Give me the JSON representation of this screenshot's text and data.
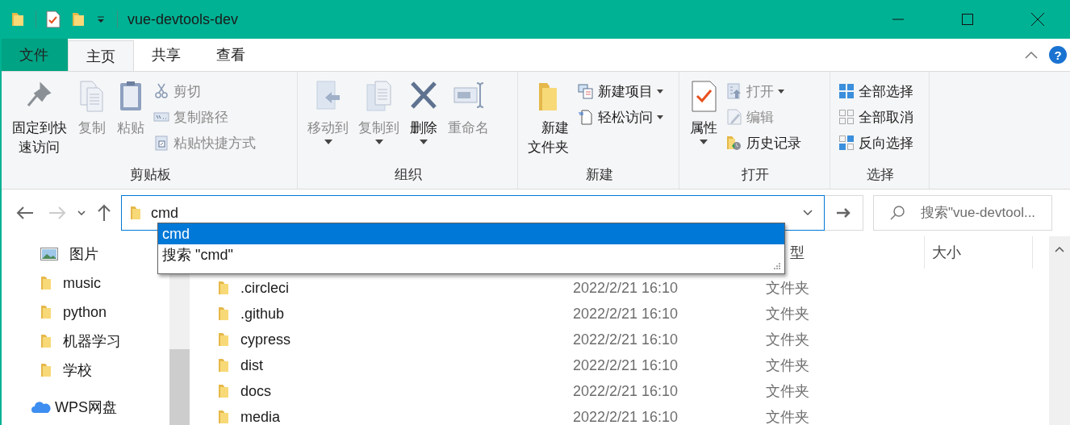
{
  "title_bar": {
    "title": "vue-devtools-dev"
  },
  "tabs": [
    {
      "label": "文件",
      "kind": "menu",
      "selected": false
    },
    {
      "label": "主页",
      "kind": "tab",
      "selected": true
    },
    {
      "label": "共享",
      "kind": "tab",
      "selected": false
    },
    {
      "label": "查看",
      "kind": "tab",
      "selected": false
    }
  ],
  "help": {
    "label": "?"
  },
  "ribbon": [
    {
      "label": "剪贴板",
      "large": [
        {
          "label": "固定到快速访问",
          "disabled": false,
          "dropdown": false
        },
        {
          "label": "复制",
          "disabled": true,
          "dropdown": false
        },
        {
          "label": "粘贴",
          "disabled": true,
          "dropdown": false
        }
      ],
      "small": [
        {
          "label": "剪切",
          "disabled": true,
          "dropdown": false
        },
        {
          "label": "复制路径",
          "disabled": true,
          "dropdown": false
        },
        {
          "label": "粘贴快捷方式",
          "disabled": true,
          "dropdown": false
        }
      ]
    },
    {
      "label": "组织",
      "large": [
        {
          "label": "移动到",
          "disabled": true,
          "dropdown": true
        },
        {
          "label": "复制到",
          "disabled": true,
          "dropdown": true
        },
        {
          "label": "删除",
          "disabled": false,
          "dropdown": true
        },
        {
          "label": "重命名",
          "disabled": true,
          "dropdown": false
        }
      ]
    },
    {
      "label": "新建",
      "large": [
        {
          "label": "新建文件夹",
          "disabled": false,
          "dropdown": false
        }
      ],
      "small": [
        {
          "label": "新建项目",
          "disabled": false,
          "dropdown": true
        },
        {
          "label": "轻松访问",
          "disabled": false,
          "dropdown": true
        }
      ]
    },
    {
      "label": "打开",
      "large": [
        {
          "label": "属性",
          "disabled": false,
          "dropdown": true
        }
      ],
      "small": [
        {
          "label": "打开",
          "disabled": true,
          "dropdown": true
        },
        {
          "label": "编辑",
          "disabled": true,
          "dropdown": false
        },
        {
          "label": "历史记录",
          "disabled": false,
          "dropdown": false
        }
      ]
    },
    {
      "label": "选择",
      "small": [
        {
          "label": "全部选择",
          "disabled": false,
          "dropdown": false
        },
        {
          "label": "全部取消",
          "disabled": false,
          "dropdown": false
        },
        {
          "label": "反向选择",
          "disabled": false,
          "dropdown": false
        }
      ]
    }
  ],
  "address_bar": {
    "value": "cmd",
    "back_disabled": false,
    "forward_disabled": true
  },
  "suggestions": [
    {
      "label": "cmd",
      "selected": true
    },
    {
      "label": "搜索 \"cmd\"",
      "selected": false
    }
  ],
  "search": {
    "placeholder": "搜索\"vue-devtool..."
  },
  "sidebar": {
    "items": [
      {
        "label": "图片",
        "kind": "pictures"
      },
      {
        "label": "music",
        "kind": "folder"
      },
      {
        "label": "python",
        "kind": "folder"
      },
      {
        "label": "机器学习",
        "kind": "folder"
      },
      {
        "label": "学校",
        "kind": "folder"
      },
      {
        "label": "WPS网盘",
        "kind": "cloud"
      }
    ]
  },
  "table": {
    "headers": {
      "type": "型",
      "size": "大小"
    },
    "rows": [
      {
        "name": ".circleci",
        "date": "2022/2/21 16:10",
        "type": "文件夹"
      },
      {
        "name": ".github",
        "date": "2022/2/21 16:10",
        "type": "文件夹"
      },
      {
        "name": "cypress",
        "date": "2022/2/21 16:10",
        "type": "文件夹"
      },
      {
        "name": "dist",
        "date": "2022/2/21 16:10",
        "type": "文件夹"
      },
      {
        "name": "docs",
        "date": "2022/2/21 16:10",
        "type": "文件夹"
      },
      {
        "name": "media",
        "date": "2022/2/21 16:10",
        "type": "文件夹"
      }
    ]
  }
}
